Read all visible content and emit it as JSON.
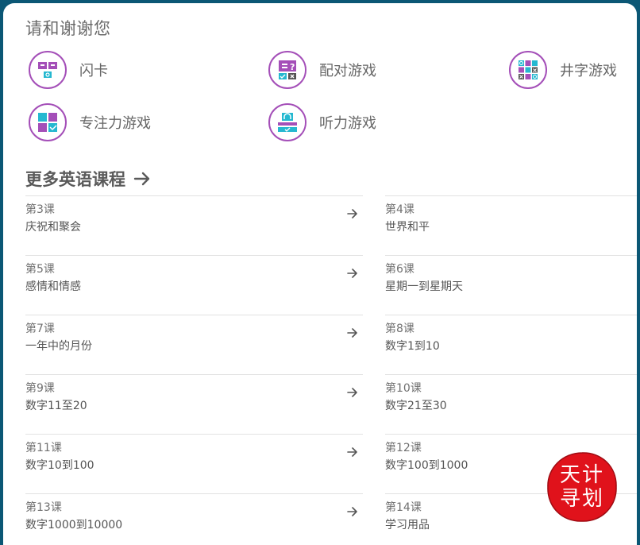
{
  "page_title": "请和谢谢您",
  "games": [
    {
      "label": "闪卡",
      "icon": "flashcard-icon"
    },
    {
      "label": "配对游戏",
      "icon": "matching-game-icon"
    },
    {
      "label": "井字游戏",
      "icon": "tic-tac-toe-icon"
    },
    {
      "label": "专注力游戏",
      "icon": "memory-game-icon"
    },
    {
      "label": "听力游戏",
      "icon": "listening-game-icon"
    }
  ],
  "more_courses": {
    "title": "更多英语课程",
    "arrow_icon": "arrow-right-icon"
  },
  "lessons_left": [
    {
      "num": "第3课",
      "name": "庆祝和聚会"
    },
    {
      "num": "第5课",
      "name": "感情和情感"
    },
    {
      "num": "第7课",
      "name": "一年中的月份"
    },
    {
      "num": "第9课",
      "name": "数字11至20"
    },
    {
      "num": "第11课",
      "name": "数字10到100"
    },
    {
      "num": "第13课",
      "name": "数字1000到10000"
    }
  ],
  "lessons_right": [
    {
      "num": "第4课",
      "name": "世界和平"
    },
    {
      "num": "第6课",
      "name": "星期一到星期天"
    },
    {
      "num": "第8课",
      "name": "数字1到10"
    },
    {
      "num": "第10课",
      "name": "数字21至30"
    },
    {
      "num": "第12课",
      "name": "数字100到1000"
    },
    {
      "num": "第14课",
      "name": "学习用品"
    }
  ],
  "watermark": {
    "line1": "天计",
    "line2": "寻划"
  },
  "colors": {
    "frame": "#0b5775",
    "purple": "#a44fb8",
    "teal": "#25b8d0",
    "stamp_red": "#e0121b"
  }
}
